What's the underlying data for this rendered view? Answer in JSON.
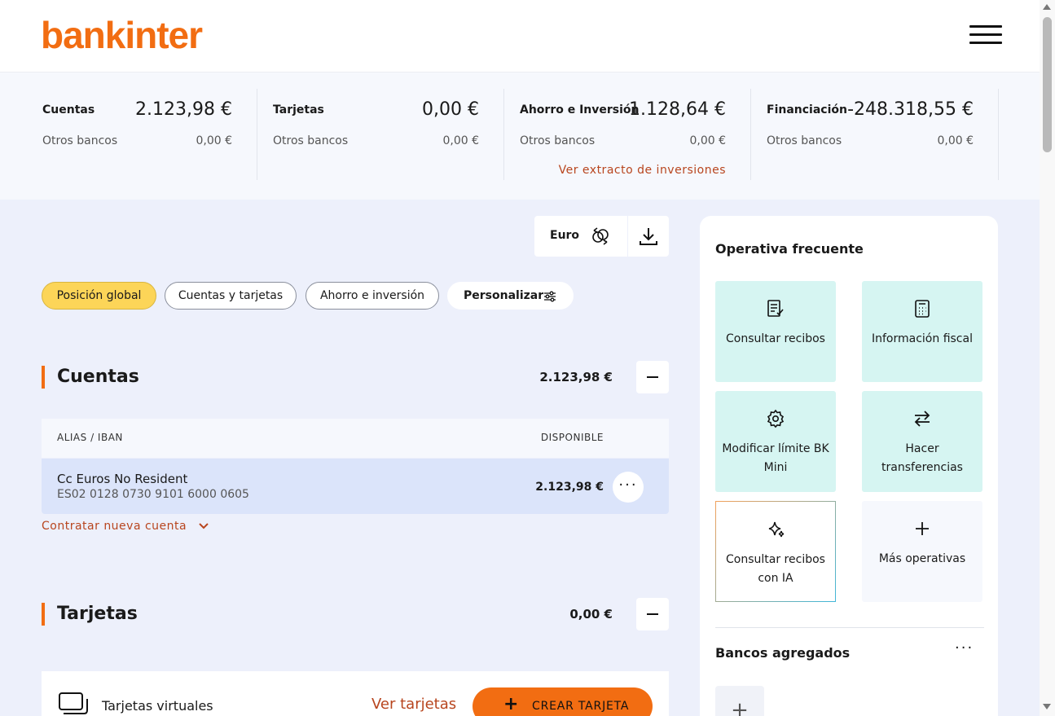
{
  "brand": {
    "logo_text": "bankinter",
    "accent": "#f26d12",
    "link_color": "#b8451e"
  },
  "header": {
    "menu_icon": "hamburger-menu-icon"
  },
  "summary": [
    {
      "title": "Cuentas",
      "value": "2.123,98 €",
      "sub_label": "Otros bancos",
      "sub_value": "0,00 €",
      "link": null
    },
    {
      "title": "Tarjetas",
      "value": "0,00 €",
      "sub_label": "Otros bancos",
      "sub_value": "0,00 €",
      "link": null
    },
    {
      "title": "Ahorro e Inversión",
      "value": "1.128,64 €",
      "sub_label": "Otros bancos",
      "sub_value": "0,00 €",
      "link": "Ver extracto de inversiones"
    },
    {
      "title": "Financiación",
      "value": "-248.318,55 €",
      "sub_label": "Otros bancos",
      "sub_value": "0,00 €",
      "link": null
    }
  ],
  "currency": {
    "label": "Euro",
    "icon": "currency-exchange-icon",
    "download_icon": "download-icon"
  },
  "tabs": [
    {
      "label": "Posición global",
      "active": true
    },
    {
      "label": "Cuentas y tarjetas",
      "active": false
    },
    {
      "label": "Ahorro e inversión",
      "active": false
    },
    {
      "label": "Personalizar",
      "icon": "sliders-icon"
    }
  ],
  "cuentas": {
    "title": "Cuentas",
    "total": "2.123,98 €",
    "columns": {
      "alias": "ALIAS / IBAN",
      "available": "DISPONIBLE"
    },
    "rows": [
      {
        "alias": "Cc Euros No Resident",
        "iban": "ES02 0128 0730 9101 6000 0605",
        "available": "2.123,98 €"
      }
    ],
    "new_account_link": "Contratar nueva cuenta"
  },
  "tarjetas": {
    "title": "Tarjetas",
    "total": "0,00 €",
    "virtual_label": "Tarjetas virtuales",
    "view_link": "Ver tarjetas",
    "create_button": "CREAR TARJETA"
  },
  "panel": {
    "title": "Operativa frecuente",
    "tiles": [
      {
        "label": "Consultar recibos",
        "icon": "receipt-list-icon"
      },
      {
        "label": "Información fiscal",
        "icon": "calculator-icon"
      },
      {
        "label": "Modificar límite BK Mini",
        "icon": "gear-icon"
      },
      {
        "label": "Hacer transferencias",
        "icon": "transfer-arrows-icon"
      },
      {
        "label": "Consultar recibos con IA",
        "icon": "ai-sparkle-icon"
      },
      {
        "label": "Más operativas",
        "icon": "plus-icon"
      }
    ],
    "banks_title": "Bancos agregados",
    "banks_more": "···"
  }
}
